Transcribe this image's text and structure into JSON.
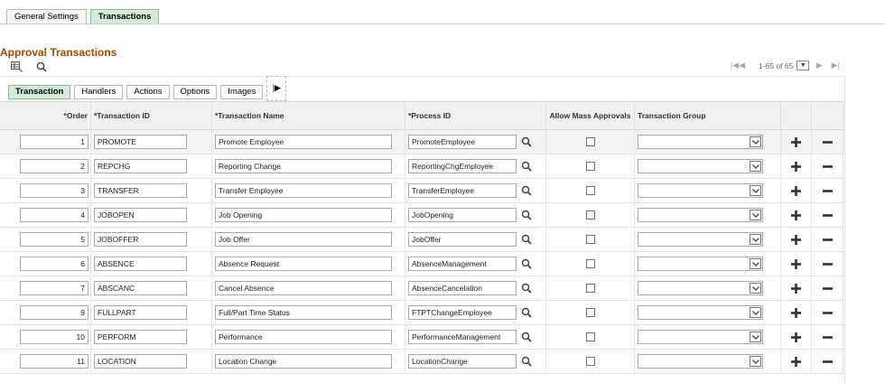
{
  "top_tabs": [
    {
      "label": "General Settings",
      "active": false
    },
    {
      "label": "Transactions",
      "active": true
    }
  ],
  "section_title": "Approval Transactions",
  "pager": {
    "count_text": "1-65 of 65"
  },
  "sub_tabs": [
    {
      "label": "Transaction",
      "active": true
    },
    {
      "label": "Handlers",
      "active": false
    },
    {
      "label": "Actions",
      "active": false
    },
    {
      "label": "Options",
      "active": false
    },
    {
      "label": "Images",
      "active": false
    }
  ],
  "columns": {
    "order": "*Order",
    "transaction_id": "*Transaction ID",
    "transaction_name": "*Transaction Name",
    "process_id": "*Process ID",
    "allow_mass": "Allow Mass Approvals",
    "transaction_group": "Transaction Group"
  },
  "rows": [
    {
      "order": "1",
      "id": "PROMOTE",
      "name": "Promote Employee",
      "process": "PromoteEmployee",
      "mass": false,
      "group": ""
    },
    {
      "order": "2",
      "id": "REPCHG",
      "name": "Reporting Change",
      "process": "ReportingChgEmployee",
      "mass": false,
      "group": ""
    },
    {
      "order": "3",
      "id": "TRANSFER",
      "name": "Transfer Employee",
      "process": "TransferEmployee",
      "mass": false,
      "group": ""
    },
    {
      "order": "4",
      "id": "JOBOPEN",
      "name": "Job Opening",
      "process": "JobOpening",
      "mass": false,
      "group": ""
    },
    {
      "order": "5",
      "id": "JOBOFFER",
      "name": "Job Offer",
      "process": "JobOffer",
      "mass": false,
      "group": ""
    },
    {
      "order": "6",
      "id": "ABSENCE",
      "name": "Absence Request",
      "process": "AbsenceManagement",
      "mass": false,
      "group": ""
    },
    {
      "order": "7",
      "id": "ABSCANC",
      "name": "Cancel Absence",
      "process": "AbsenceCancelation",
      "mass": false,
      "group": ""
    },
    {
      "order": "9",
      "id": "FULLPART",
      "name": "Full/Part Time Status",
      "process": "FTPTChangeEmployee",
      "mass": false,
      "group": ""
    },
    {
      "order": "10",
      "id": "PERFORM",
      "name": "Performance",
      "process": "PerformanceManagement",
      "mass": false,
      "group": ""
    },
    {
      "order": "11",
      "id": "LOCATION",
      "name": "Location Change",
      "process": "LocationChange",
      "mass": false,
      "group": ""
    }
  ],
  "colors": {
    "tab_active": "#d3ecd9",
    "title": "#a34b00",
    "header_bg": "#f0f0f0"
  }
}
